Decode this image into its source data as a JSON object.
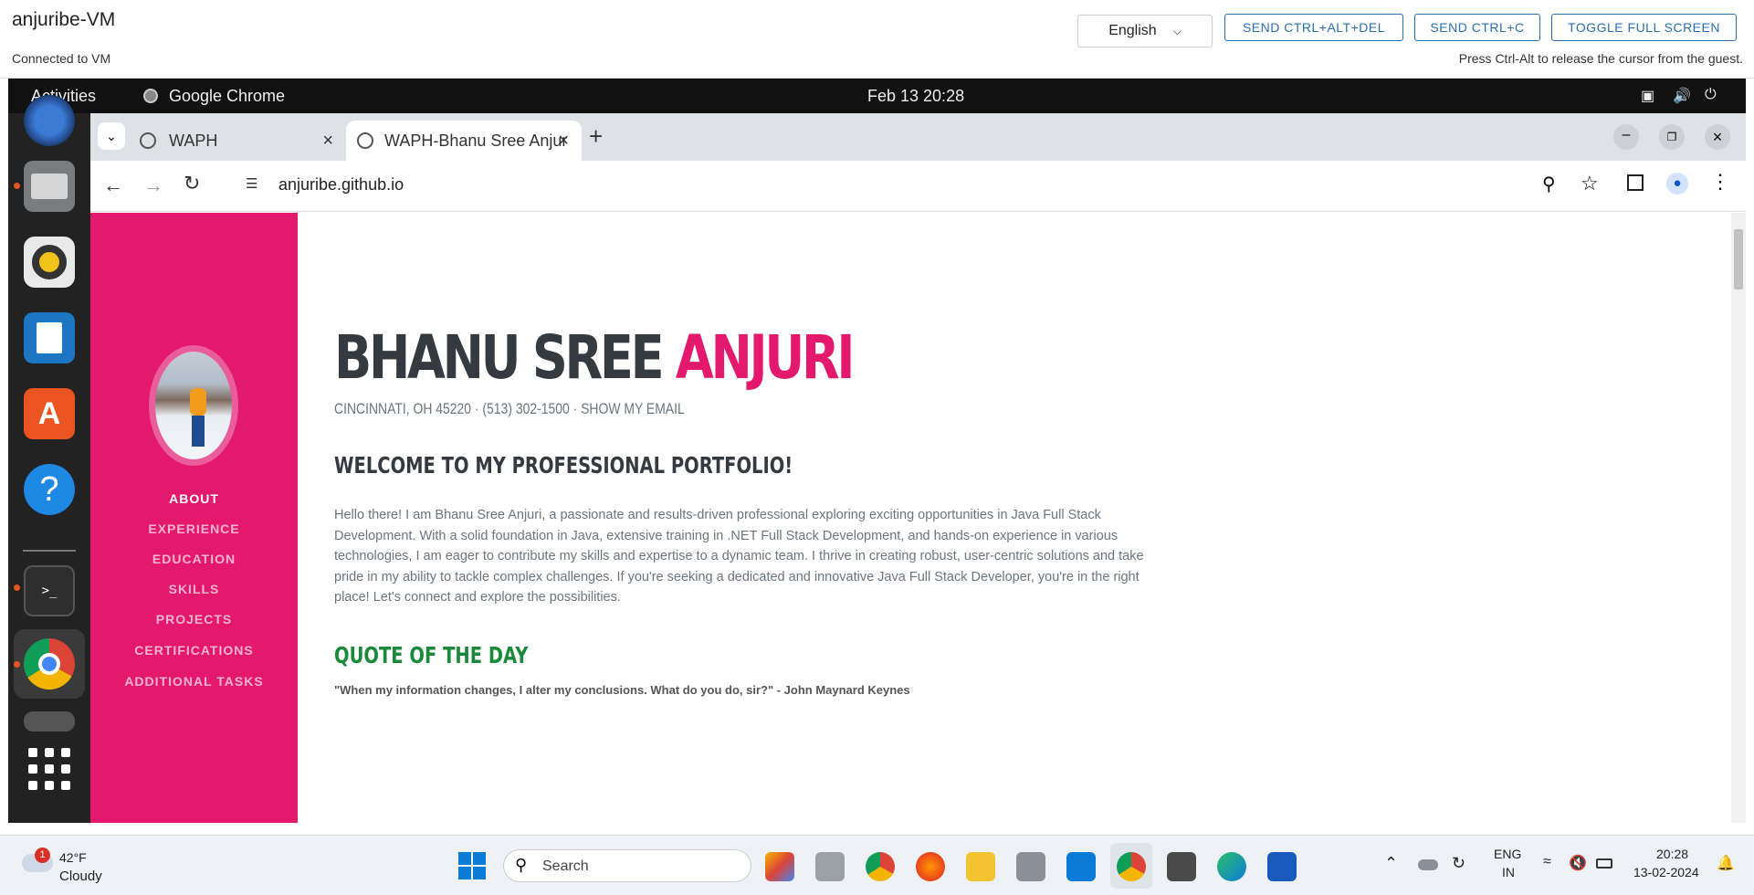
{
  "vm": {
    "title": "anjuribe-VM",
    "status": "Connected to VM",
    "language": "English",
    "btn_ctrl_alt_del": "SEND CTRL+ALT+DEL",
    "btn_ctrl_c": "SEND CTRL+C",
    "btn_fullscreen": "TOGGLE FULL SCREEN",
    "hint": "Press Ctrl-Alt to release the cursor from the guest."
  },
  "guest": {
    "activities": "Activities",
    "app": "Google Chrome",
    "datetime": "Feb 13  20:28"
  },
  "browser": {
    "tabs": [
      {
        "title": "WAPH"
      },
      {
        "title": "WAPH-Bhanu Sree Anjur"
      }
    ],
    "url": "anjuribe.github.io"
  },
  "page": {
    "nav": [
      "ABOUT",
      "EXPERIENCE",
      "EDUCATION",
      "SKILLS",
      "PROJECTS",
      "CERTIFICATIONS",
      "ADDITIONAL TASKS"
    ],
    "name_first": "BHANU SREE",
    "name_last": "ANJURI",
    "contact": "Cincinnati, OH 45220 · (513) 302-1500 · Show my Email",
    "welcome": "WELCOME TO MY PROFESSIONAL PORTFOLIO!",
    "intro": "Hello there! I am Bhanu Sree Anjuri, a passionate and results-driven professional exploring exciting opportunities in Java Full Stack Development. With a solid foundation in Java, extensive training in .NET Full Stack Development, and hands-on experience in various technologies, I am eager to contribute my skills and expertise to a dynamic team. I thrive in creating robust, user-centric solutions and take pride in my ability to tackle complex challenges. If you're seeking a dedicated and innovative Java Full Stack Developer, you're in the right place! Let's connect and explore the possibilities.",
    "quote_heading": "QUOTE OF THE DAY",
    "quote": "\"When my information changes, I alter my conclusions. What do you do, sir?\" - John Maynard Keynes"
  },
  "taskbar": {
    "temp": "42°F",
    "weather": "Cloudy",
    "weather_badge": "1",
    "search": "Search",
    "lang1": "ENG",
    "lang2": "IN",
    "time": "20:28",
    "date": "13-02-2024"
  }
}
